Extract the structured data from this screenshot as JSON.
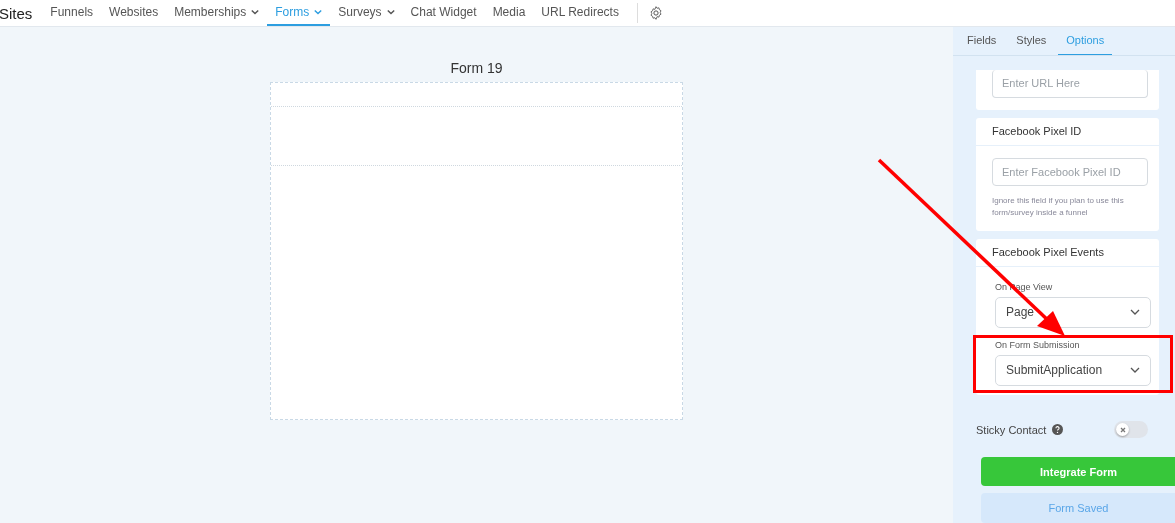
{
  "nav": {
    "brand": "Sites",
    "items": [
      {
        "label": "Funnels",
        "dropdown": false,
        "selected": false
      },
      {
        "label": "Websites",
        "dropdown": false,
        "selected": false
      },
      {
        "label": "Memberships",
        "dropdown": true,
        "selected": false
      },
      {
        "label": "Forms",
        "dropdown": true,
        "selected": true
      },
      {
        "label": "Surveys",
        "dropdown": true,
        "selected": false
      },
      {
        "label": "Chat Widget",
        "dropdown": false,
        "selected": false
      },
      {
        "label": "Media",
        "dropdown": false,
        "selected": false
      },
      {
        "label": "URL Redirects",
        "dropdown": false,
        "selected": false
      }
    ]
  },
  "canvas": {
    "title": "Form 19"
  },
  "panel": {
    "tabs": [
      {
        "label": "Fields",
        "selected": false
      },
      {
        "label": "Styles",
        "selected": false
      },
      {
        "label": "Options",
        "selected": true
      }
    ],
    "url_field": {
      "placeholder": "Enter URL Here"
    },
    "pixel_id": {
      "title": "Facebook Pixel ID",
      "placeholder": "Enter Facebook Pixel ID",
      "help": "Ignore this field if you plan to use this form/survey inside a funnel"
    },
    "pixel_events": {
      "title": "Facebook Pixel Events",
      "fields": [
        {
          "label": "On Page View",
          "value": "Page",
          "highlighted": false
        },
        {
          "label": "On Form Submission",
          "value": "SubmitApplication",
          "highlighted": true
        }
      ]
    },
    "sticky_contact": {
      "label": "Sticky Contact",
      "on": false
    },
    "buttons": [
      {
        "label": "Integrate Form",
        "kind": "primary"
      },
      {
        "label": "Form Saved",
        "kind": "secondary"
      }
    ]
  },
  "annotations": [
    {
      "kind": "arrow"
    }
  ]
}
